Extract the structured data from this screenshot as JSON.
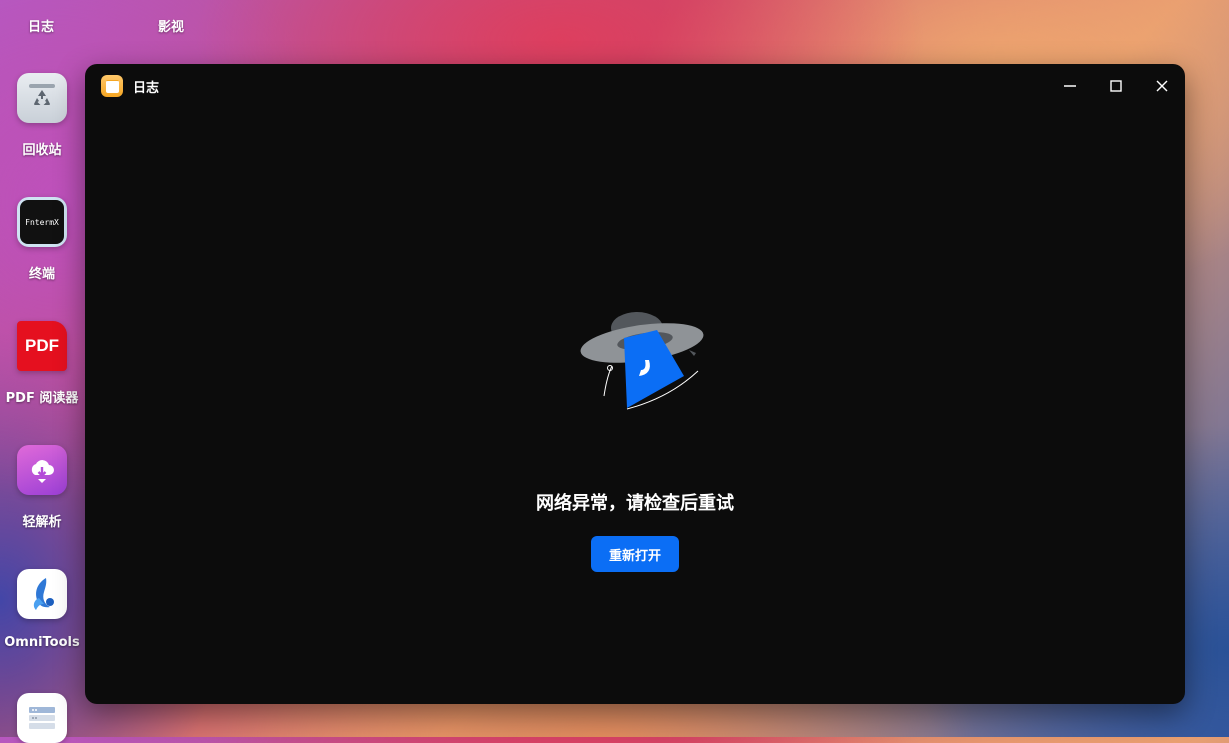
{
  "desktop": {
    "top_labels": [
      "日志",
      "影视"
    ],
    "icons": [
      {
        "label": "回收站",
        "icon": "recycle-bin-icon"
      },
      {
        "label": "终端",
        "icon": "terminal-icon",
        "icon_text": "FntermX"
      },
      {
        "label": "PDF 阅读器",
        "icon": "pdf-reader-icon",
        "icon_text": "PDF"
      },
      {
        "label": "轻解析",
        "icon": "cloud-download-icon"
      },
      {
        "label": "OmniTools",
        "icon": "omnitools-icon"
      },
      {
        "label": "",
        "icon": "list-app-icon"
      }
    ]
  },
  "window": {
    "title": "日志",
    "icon": "log-app-icon",
    "controls": [
      "minimize-icon",
      "maximize-icon",
      "close-icon"
    ],
    "error_message": "网络异常，请检查后重试",
    "reopen_button": "重新打开",
    "accent_color": "#0b6ef5"
  }
}
